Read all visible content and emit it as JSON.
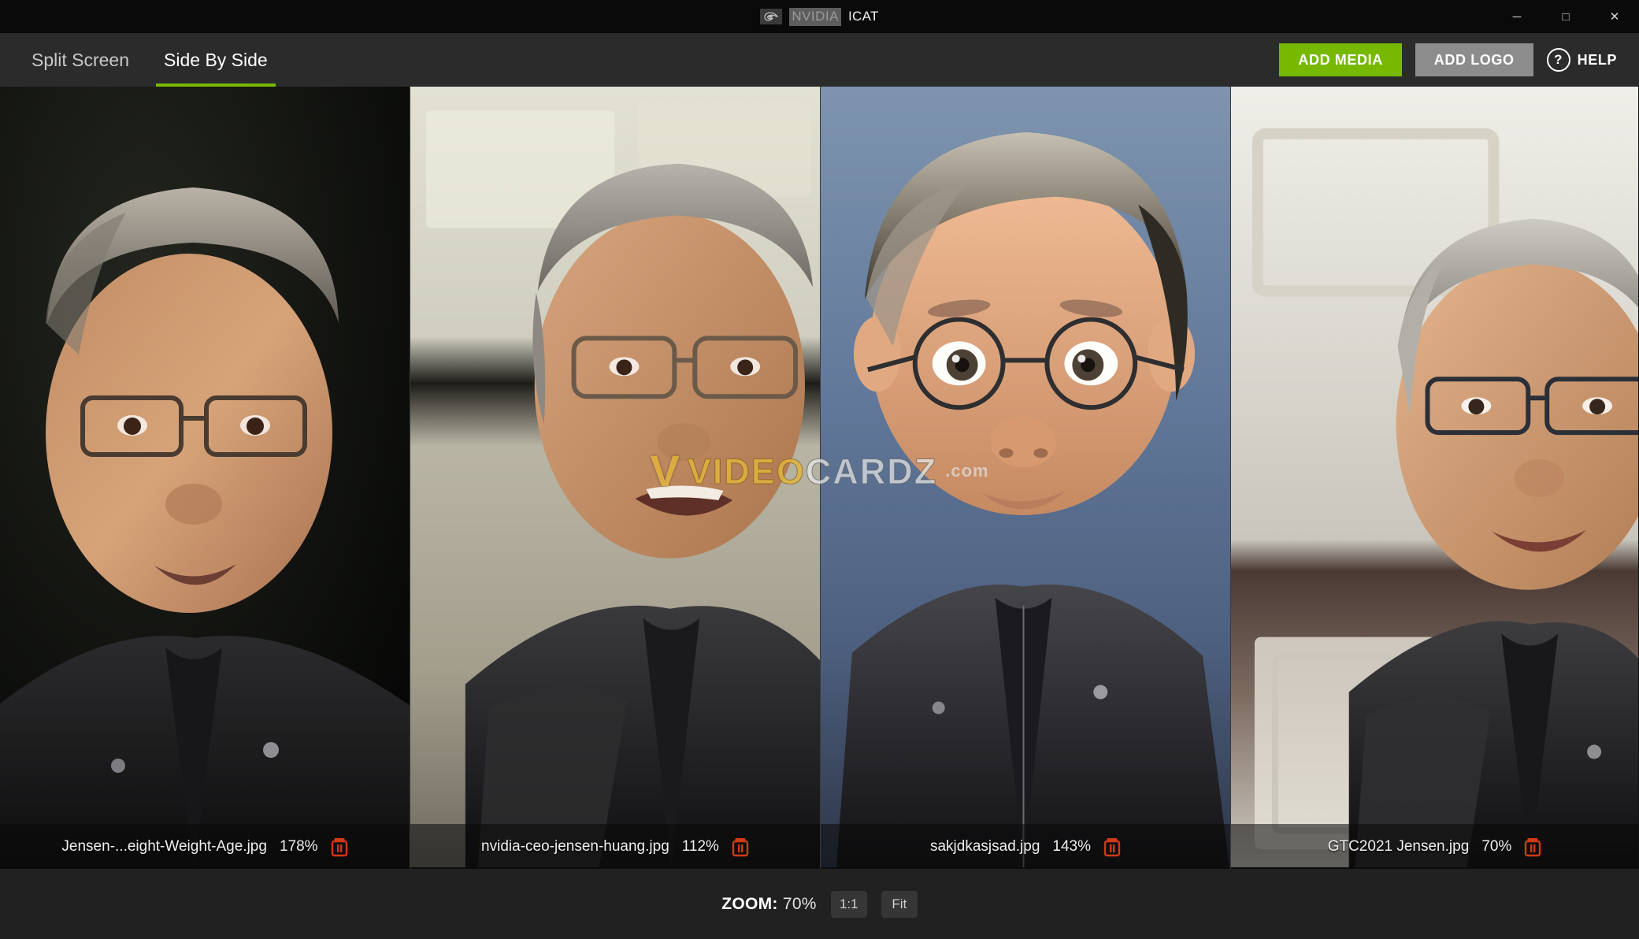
{
  "window": {
    "title_brand": "NVIDIA",
    "title_app": "ICAT",
    "logo_icon": "nvidia-eye-logo",
    "controls": {
      "minimize": "─",
      "maximize": "□",
      "close": "✕"
    }
  },
  "toolbar": {
    "tabs": [
      {
        "label": "Split Screen",
        "active": false
      },
      {
        "label": "Side By Side",
        "active": true
      }
    ],
    "add_media_label": "ADD MEDIA",
    "add_logo_label": "ADD LOGO",
    "help_label": "HELP",
    "help_icon_glyph": "?",
    "accent_green": "#76b900",
    "secondary_gray": "#8c8c8c"
  },
  "panes": [
    {
      "filename": "Jensen-...eight-Weight-Age.jpg",
      "zoom": "178%",
      "delete_icon": "trash-icon",
      "image_alt": "Close-up portrait of a man with gray hair and glasses on a dark background"
    },
    {
      "filename": "nvidia-ceo-jensen-huang.jpg",
      "zoom": "112%",
      "delete_icon": "trash-icon",
      "image_alt": "Man with gray hair and glasses speaking, pale carved stone background"
    },
    {
      "filename": "sakjdkasjsad.jpg",
      "zoom": "143%",
      "delete_icon": "trash-icon",
      "image_alt": "3D cartoon caricature avatar with gray hair and glasses, blue background"
    },
    {
      "filename": "GTC2021 Jensen.jpg",
      "zoom": "70%",
      "delete_icon": "trash-icon",
      "image_alt": "Man with gray hair and glasses smiling, white carved panel background"
    }
  ],
  "bottom_bar": {
    "zoom_prefix": "ZOOM:",
    "zoom_value": "70%",
    "one_to_one_label": "1:1",
    "fit_label": "Fit"
  },
  "watermark": {
    "mark": "V",
    "text_a": "VIDEO",
    "text_b": "CARDZ",
    "suffix": ".com"
  }
}
